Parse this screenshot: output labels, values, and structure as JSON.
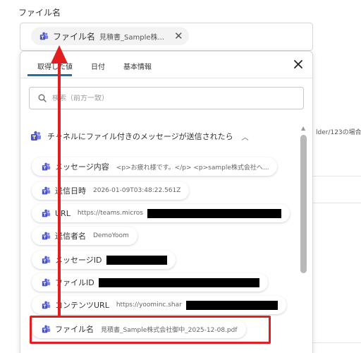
{
  "field": {
    "label": "ファイル名"
  },
  "chip": {
    "name": "ファイル名",
    "value": "見積書_Sample株...",
    "close_icon": "close-icon"
  },
  "background": {
    "side_text": "lder/123の場合,"
  },
  "popup": {
    "tabs": [
      {
        "label": "取得した値",
        "active": true
      },
      {
        "label": "日付",
        "active": false
      },
      {
        "label": "基本情報",
        "active": false
      }
    ],
    "close_icon": "close-icon",
    "search": {
      "placeholder": "検索（前方一致）",
      "icon": "search-icon"
    },
    "section": {
      "title": "チャネルにファイル付きのメッセージが送信されたら",
      "caret": "chevron-up-icon"
    },
    "items": [
      {
        "name": "メッセージ内容",
        "value": "<p>お疲れ様です。</p> <p>sample株式会社へ..."
      },
      {
        "name": "送信日時",
        "value": "2026-01-09T03:48:22.561Z"
      },
      {
        "name": "URL",
        "value": "https://teams.micros",
        "redacted": true
      },
      {
        "name": "送信者名",
        "value": "DemoYoom"
      },
      {
        "name": "メッセージID",
        "value": "",
        "redacted": true
      },
      {
        "name": "ファイルID",
        "value": "",
        "redacted": true
      },
      {
        "name": "コンテンツURL",
        "value": "https://yoominc.shar",
        "redacted": true
      },
      {
        "name": "ファイル名",
        "value": "見積書_Sample株式会社御中_2025-12-08.pdf"
      }
    ]
  },
  "colors": {
    "accent": "#1f6fa8",
    "highlight": "#e02020",
    "teams": "#5059c9"
  }
}
